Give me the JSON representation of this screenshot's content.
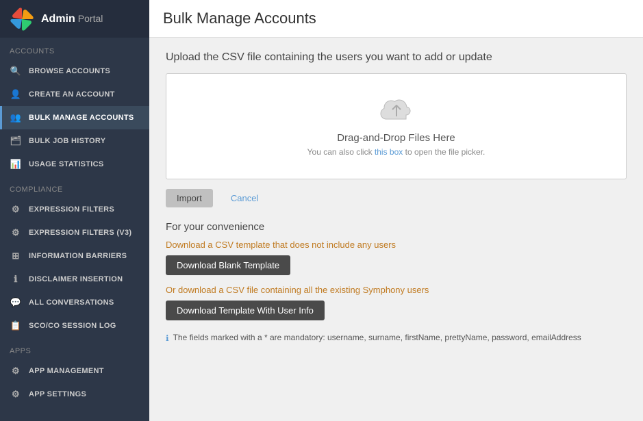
{
  "sidebar": {
    "brand": {
      "admin": "Admin",
      "portal": "Portal"
    },
    "sections": [
      {
        "label": "Accounts",
        "items": [
          {
            "id": "browse-accounts",
            "icon": "🔍",
            "label": "Browse Accounts",
            "active": false
          },
          {
            "id": "create-account",
            "icon": "👤",
            "label": "Create an Account",
            "active": false
          },
          {
            "id": "bulk-manage-accounts",
            "icon": "👥",
            "label": "Bulk Manage Accounts",
            "active": true
          },
          {
            "id": "bulk-job-history",
            "icon": "🗂",
            "label": "Bulk Job History",
            "active": false
          },
          {
            "id": "usage-statistics",
            "icon": "📊",
            "label": "Usage Statistics",
            "active": false
          }
        ]
      },
      {
        "label": "Compliance",
        "items": [
          {
            "id": "expression-filters",
            "icon": "⚙",
            "label": "Expression Filters",
            "active": false
          },
          {
            "id": "expression-filters-v3",
            "icon": "⚙",
            "label": "Expression Filters (V3)",
            "active": false
          },
          {
            "id": "information-barriers",
            "icon": "⊞",
            "label": "Information Barriers",
            "active": false
          },
          {
            "id": "disclaimer-insertion",
            "icon": "ℹ",
            "label": "Disclaimer Insertion",
            "active": false
          },
          {
            "id": "all-conversations",
            "icon": "💬",
            "label": "All Conversations",
            "active": false
          },
          {
            "id": "sco-co-session-log",
            "icon": "📋",
            "label": "SCO/CO Session Log",
            "active": false
          }
        ]
      },
      {
        "label": "Apps",
        "items": [
          {
            "id": "app-management",
            "icon": "⚙",
            "label": "App Management",
            "active": false
          },
          {
            "id": "app-settings",
            "icon": "⚙",
            "label": "App Settings",
            "active": false
          }
        ]
      }
    ]
  },
  "main": {
    "title": "Bulk Manage Accounts",
    "upload_title": "Upload the CSV file containing the users you want to add or update",
    "dropzone": {
      "main_text": "Drag-and-Drop Files Here",
      "sub_text": "You can also click ",
      "link_text": "this box",
      "sub_text2": " to open the file picker."
    },
    "buttons": {
      "import": "Import",
      "cancel": "Cancel"
    },
    "convenience": {
      "title": "For your convenience",
      "blank_desc": "Download a CSV template that does not include any users",
      "blank_btn": "Download Blank Template",
      "user_desc": "Or download a CSV file containing all the existing Symphony users",
      "user_btn": "Download Template With User Info",
      "mandatory_note": "The fields marked with a * are mandatory: username, surname, firstName, prettyName, password, emailAddress"
    }
  }
}
